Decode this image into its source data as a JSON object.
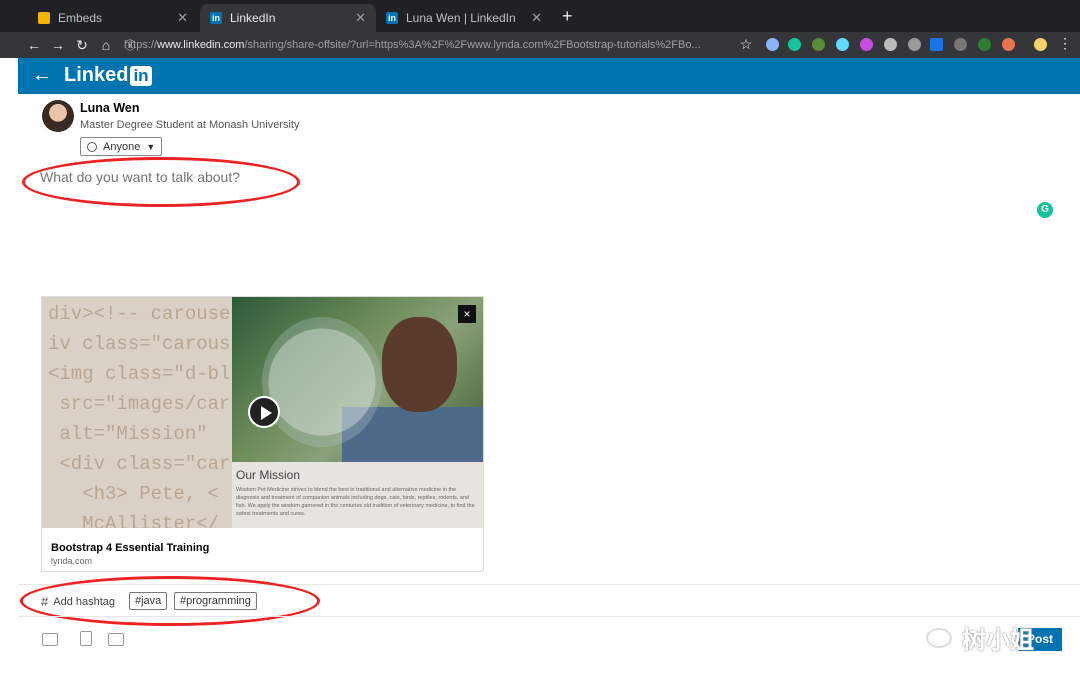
{
  "browser": {
    "tabs": [
      {
        "title": "Embeds",
        "active": false
      },
      {
        "title": "LinkedIn",
        "active": true
      },
      {
        "title": "Luna Wen | LinkedIn",
        "active": false
      }
    ],
    "url_prefix": "https://",
    "url_domain": "www.linkedin.com",
    "url_rest": "/sharing/share-offsite/?url=https%3A%2F%2Fwww.lynda.com%2FBootstrap-tutorials%2FBo...",
    "new_tab": "+"
  },
  "header": {
    "logo_text": "Linked",
    "logo_in": "in",
    "accent_color": "#0073b1"
  },
  "composer": {
    "author_name": "Luna Wen",
    "author_headline": "Master Degree Student at Monash University",
    "visibility": "Anyone",
    "placeholder": "What do you want to talk about?"
  },
  "link_card": {
    "code_lines": "div><!-- carouse\niv class=\"carous\n<img class=\"d-bl\n src=\"images/car\n alt=\"Mission\"\n <div class=\"car\n   <h3> Pete, <\n   McAllister</",
    "mission_title": "Our Mission",
    "mission_text": "Wisdom Pet Medicine strives to blend the best in traditional and alternative medicine in the diagnosis and treatment of companion animals including dogs, cats, birds, reptiles, rodents, and fish. We apply the wisdom garnered in the centuries old tradition of veterinary medicine, to find the safest treatments and cures.",
    "close": "×",
    "title": "Bootstrap 4 Essential Training",
    "domain": "lynda.com"
  },
  "hashtags": {
    "add_label": "Add hashtag",
    "tags": [
      "#java",
      "#programming"
    ]
  },
  "footer": {
    "post_button": "Post"
  },
  "watermark": "树小姐"
}
